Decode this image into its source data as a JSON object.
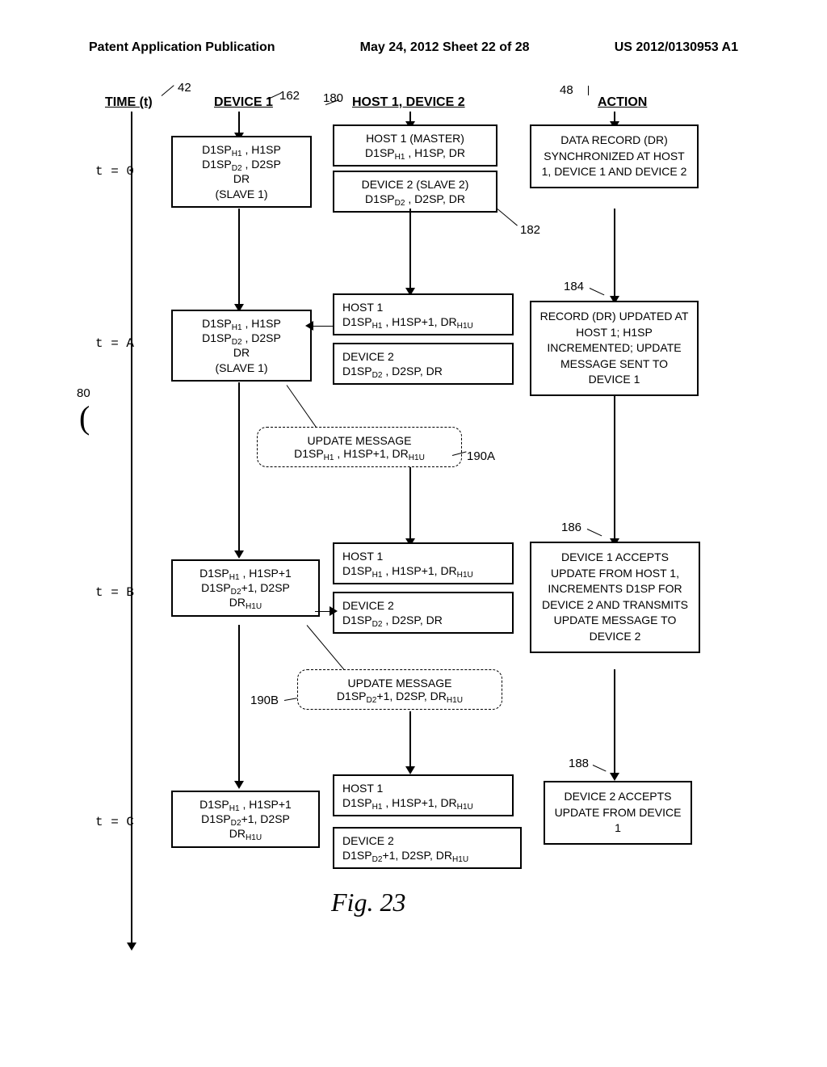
{
  "header": {
    "left": "Patent Application Publication",
    "center": "May 24, 2012  Sheet 22 of 28",
    "right": "US 2012/0130953 A1"
  },
  "columns": {
    "time": "TIME (t)",
    "device1": "DEVICE 1",
    "host": "HOST 1, DEVICE 2",
    "action": "ACTION"
  },
  "refs": {
    "r42": "42",
    "r162": "162",
    "r180": "180",
    "r48": "48",
    "r80": "80",
    "r182": "182",
    "r184": "184",
    "r186": "186",
    "r188": "188",
    "r190a": "190A",
    "r190b": "190B"
  },
  "times": {
    "t0": "t = 0",
    "tA": "t = A",
    "tB": "t = B",
    "tC": "t = C"
  },
  "boxes": {
    "d1_t0_l1": "D1SP",
    "d1_t0_l1s": "H1",
    "d1_t0_l1b": " , H1SP",
    "d1_t0_l2": "D1SP",
    "d1_t0_l2s": "D2",
    "d1_t0_l2b": " , D2SP",
    "d1_t0_l3": "DR",
    "d1_t0_l4": "(SLAVE 1)",
    "h1_t0_title": "HOST 1 (MASTER)",
    "h1_t0_body": "D1SP",
    "h1_t0_bodys": "H1",
    "h1_t0_bodye": " , H1SP, DR",
    "d2_t0_title": "DEVICE 2 (SLAVE 2)",
    "d2_t0_body": "D1SP",
    "d2_t0_bodys": "D2",
    "d2_t0_bodye": " , D2SP, DR",
    "action_t0": "DATA RECORD (DR) SYNCHRONIZED AT HOST 1, DEVICE 1 AND DEVICE 2",
    "h1_tA_title": "HOST 1",
    "h1_tA_body": "D1SP",
    "h1_tA_bodys": "H1",
    "h1_tA_bodye": " , H1SP+1, DR",
    "h1_tA_bodye2": "H1U",
    "d2_tA_title": "DEVICE 2",
    "d2_tA_body": "D1SP",
    "d2_tA_bodys": "D2",
    "d2_tA_bodye": " , D2SP, DR",
    "action_tA": "RECORD (DR) UPDATED AT HOST 1; H1SP INCREMENTED; UPDATE MESSAGE SENT TO DEVICE 1",
    "msg1_title": "UPDATE  MESSAGE",
    "msg1_body": "D1SP",
    "msg1_bodys": "H1",
    "msg1_bodye": " , H1SP+1, DR",
    "msg1_bodye2": "H1U",
    "d1_tB_l1": "D1SP",
    "d1_tB_l1s": "H1",
    "d1_tB_l1b": " , H1SP+1",
    "d1_tB_l2": "D1SP",
    "d1_tB_l2s": "D2",
    "d1_tB_l2b": "+1, D2SP",
    "d1_tB_l3": "DR",
    "d1_tB_l3s": "H1U",
    "action_tB": "DEVICE 1 ACCEPTS UPDATE FROM HOST 1, INCREMENTS D1SP FOR DEVICE 2 AND TRANSMITS UPDATE MESSAGE TO DEVICE 2",
    "msg2_title": "UPDATE  MESSAGE",
    "msg2_body": "D1SP",
    "msg2_bodys": "D2",
    "msg2_bodye": "+1, D2SP, DR",
    "msg2_bodye2": "H1U",
    "d2_tC_title": "DEVICE 2",
    "d2_tC_body": "D1SP",
    "d2_tC_bodys": "D2",
    "d2_tC_bodye": "+1, D2SP, DR",
    "d2_tC_bodye2": "H1U",
    "action_tC": "DEVICE 2 ACCEPTS UPDATE FROM DEVICE 1"
  },
  "figure": "Fig. 23"
}
